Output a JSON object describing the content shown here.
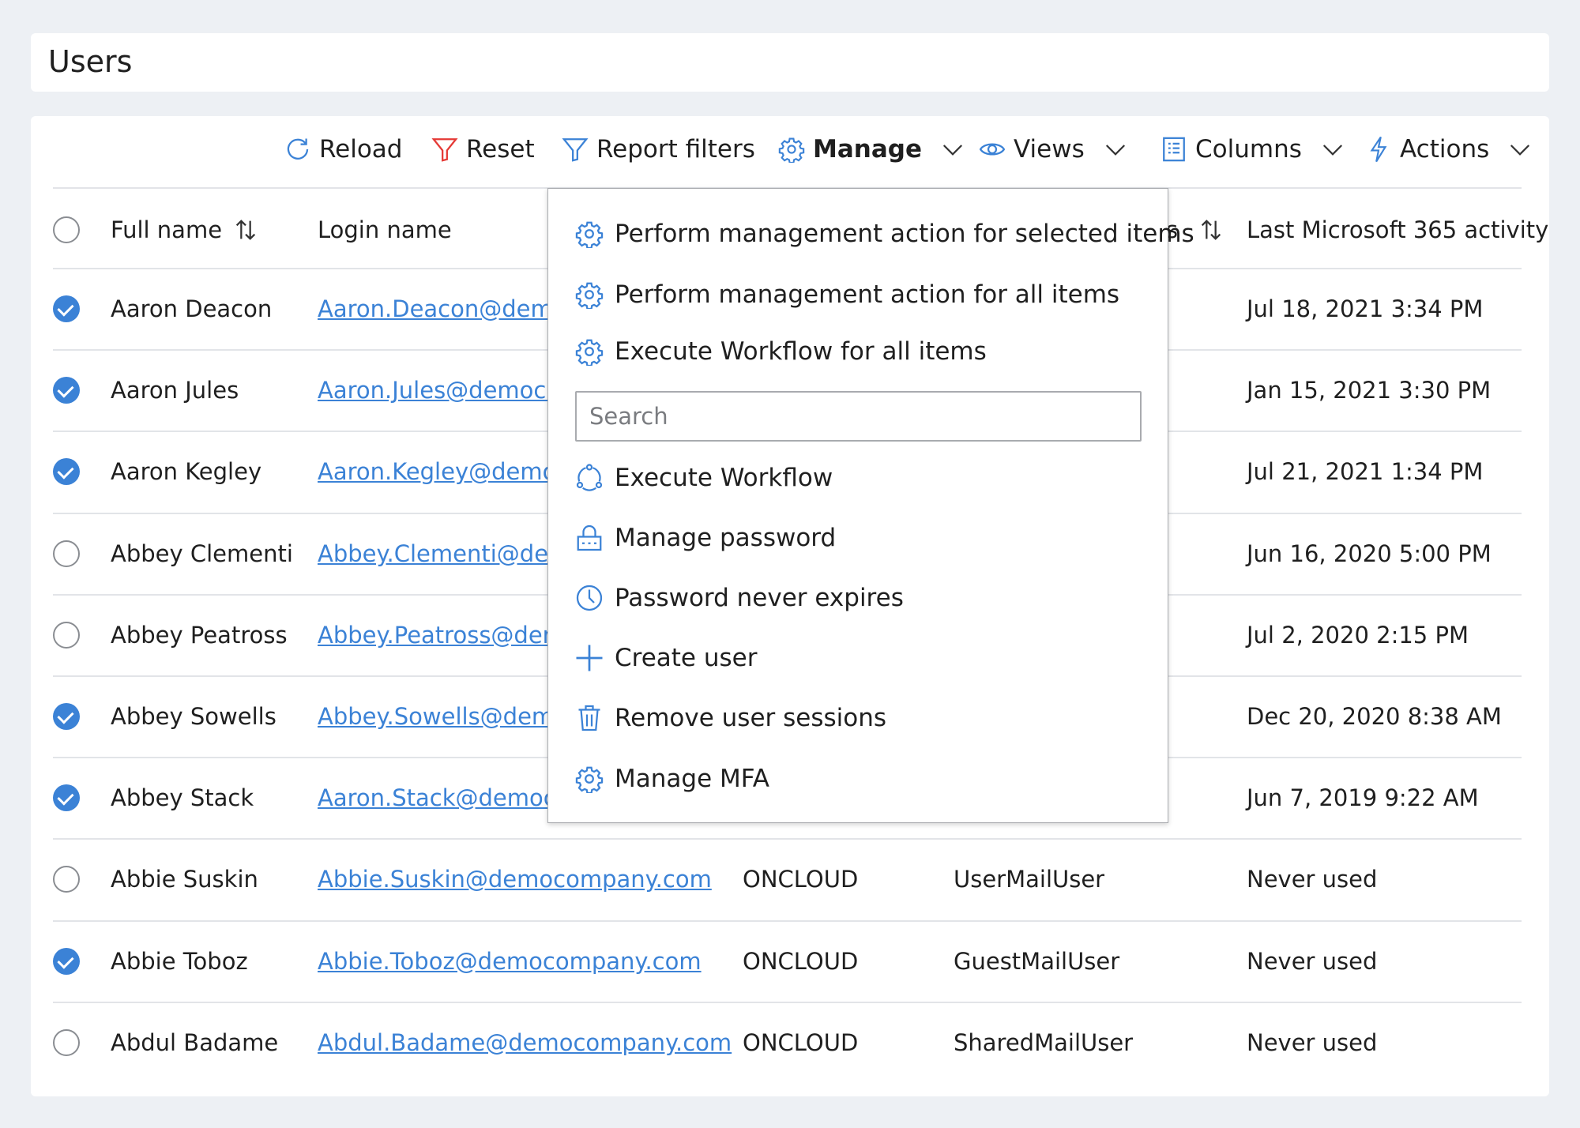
{
  "header": {
    "title": "Users"
  },
  "toolbar": {
    "reload": "Reload",
    "reset": "Reset",
    "report_filters": "Report filters",
    "manage": "Manage",
    "views": "Views",
    "columns": "Columns",
    "actions": "Actions"
  },
  "colors": {
    "accent": "#3b82d6",
    "reset": "#e53935"
  },
  "table": {
    "headers": {
      "full_name": "Full name",
      "login_name": "Login name",
      "partial": "s",
      "last_activity": "Last Microsoft 365 activity"
    },
    "rows": [
      {
        "name": "Aaron Deacon",
        "login": "Aaron.Deacon@demo",
        "source": "",
        "type": "",
        "activity": "Jul 18, 2021 3:34 PM",
        "checked": true
      },
      {
        "name": "Aaron Jules",
        "login": "Aaron.Jules@democo",
        "source": "",
        "type": "",
        "activity": "Jan 15, 2021 3:30 PM",
        "checked": true
      },
      {
        "name": "Aaron Kegley",
        "login": "Aaron.Kegley@democ",
        "source": "",
        "type": "",
        "activity": "Jul 21, 2021 1:34 PM",
        "checked": true
      },
      {
        "name": "Abbey Clementi",
        "login": "Abbey.Clementi@dem",
        "source": "",
        "type": "",
        "activity": "Jun 16, 2020 5:00 PM",
        "checked": false
      },
      {
        "name": "Abbey Peatross",
        "login": "Abbey.Peatross@dem",
        "source": "",
        "type": "",
        "activity": "Jul 2, 2020 2:15 PM",
        "checked": false
      },
      {
        "name": "Abbey Sowells",
        "login": "Abbey.Sowells@demo",
        "source": "",
        "type": "",
        "activity": "Dec 20, 2020 8:38 AM",
        "checked": true
      },
      {
        "name": "Abbey Stack",
        "login": "Aaron.Stack@democo",
        "source": "",
        "type": "",
        "activity": "Jun 7, 2019 9:22 AM",
        "checked": true
      },
      {
        "name": "Abbie Suskin",
        "login": "Abbie.Suskin@democompany.com",
        "source": "ONCLOUD",
        "type": "UserMailUser",
        "activity": "Never used",
        "checked": false
      },
      {
        "name": "Abbie Toboz",
        "login": "Abbie.Toboz@democompany.com",
        "source": "ONCLOUD",
        "type": "GuestMailUser",
        "activity": "Never used",
        "checked": true
      },
      {
        "name": "Abdul Badame",
        "login": "Abdul.Badame@democompany.com",
        "source": "ONCLOUD",
        "type": "SharedMailUser",
        "activity": "Never used",
        "checked": false
      }
    ]
  },
  "manage_menu": {
    "top_items": [
      {
        "label": "Perform management action for selected items",
        "icon": "gear-icon"
      },
      {
        "label": "Perform management action for all items",
        "icon": "gear-icon"
      },
      {
        "label": "Execute Workflow for all items",
        "icon": "gear-icon"
      }
    ],
    "search_placeholder": "Search",
    "items": [
      {
        "label": "Execute Workflow",
        "icon": "workflow-icon"
      },
      {
        "label": "Manage password",
        "icon": "password-lock-icon"
      },
      {
        "label": "Password never expires",
        "icon": "clock-icon"
      },
      {
        "label": "Create user",
        "icon": "plus-icon"
      },
      {
        "label": "Remove user sessions",
        "icon": "trash-icon"
      },
      {
        "label": "Manage MFA",
        "icon": "gear-icon"
      }
    ]
  }
}
